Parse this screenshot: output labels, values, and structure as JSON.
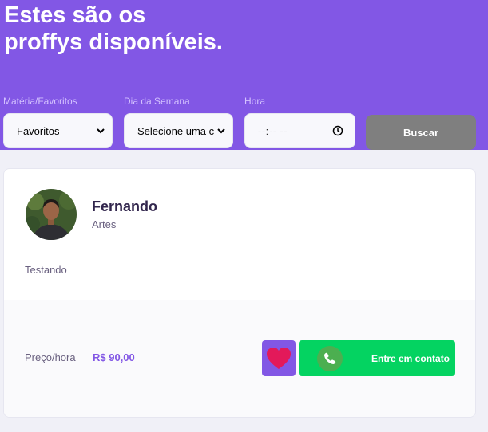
{
  "header": {
    "title_line1": "Estes são os",
    "title_line2": "proffys disponíveis."
  },
  "filters": {
    "subject": {
      "label": "Matéria/Favoritos",
      "value": "Favoritos"
    },
    "weekday": {
      "label": "Dia da Semana",
      "value": "Selecione uma c"
    },
    "time": {
      "label": "Hora",
      "value": "--:-- --"
    },
    "search_label": "Buscar"
  },
  "teacher": {
    "name": "Fernando",
    "subject": "Artes",
    "bio": "Testando",
    "price_label": "Preço/hora",
    "price_value": "R$ 90,00",
    "contact_label": "Entre em contato"
  },
  "colors": {
    "purple": "#8257E5",
    "green": "#04D361",
    "heart": "#E3195A",
    "button_gray": "#7F7F7F"
  },
  "icons": {
    "favorite": "heart-icon",
    "contact": "whatsapp-icon",
    "time": "clock-icon",
    "dropdown": "chevron-down-icon"
  }
}
